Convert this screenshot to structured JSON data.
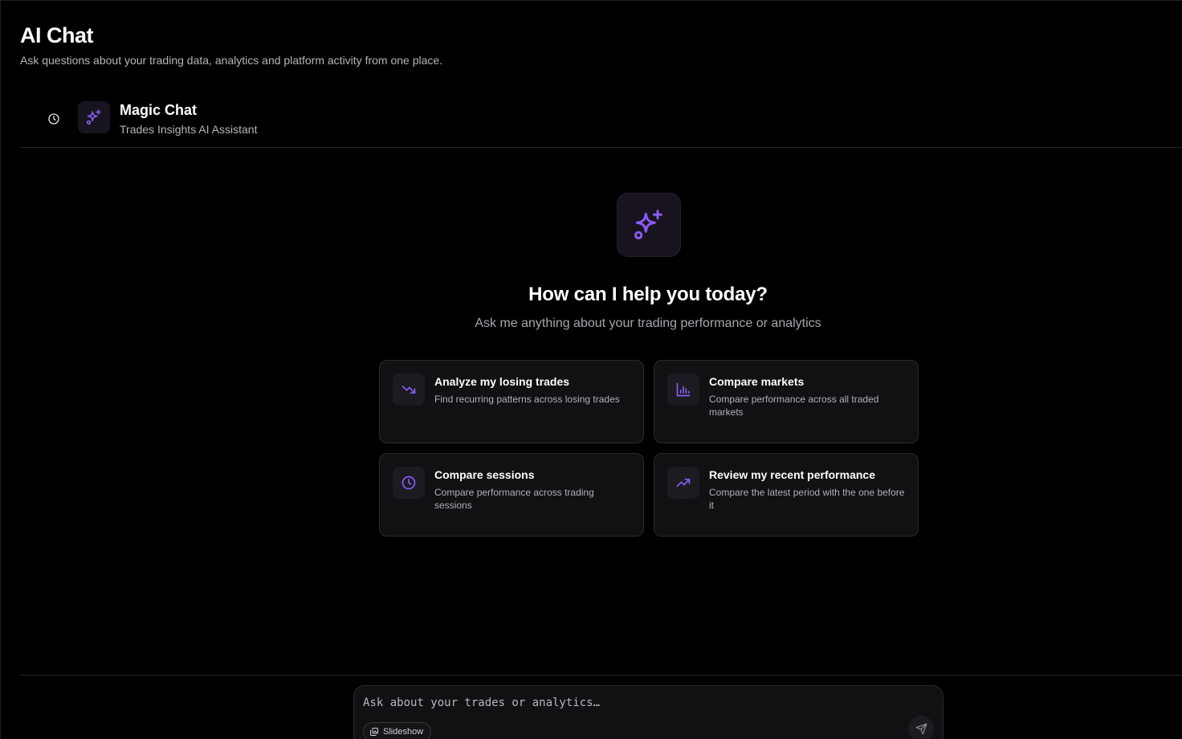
{
  "page": {
    "title": "AI Chat",
    "subtitle": "Ask questions about your trading data, analytics and platform activity from one place."
  },
  "chat_header": {
    "history_icon": "clock-icon",
    "avatar_icon": "sparkles-icon",
    "assistant_name": "Magic Chat",
    "assistant_role": "Trades Insights AI Assistant"
  },
  "hero": {
    "icon": "sparkles-icon",
    "title": "How can I help you today?",
    "subtitle": "Ask me anything about your trading performance or analytics"
  },
  "suggestions": [
    {
      "icon": "trending-down-icon",
      "title": "Analyze my losing trades",
      "description": "Find recurring patterns across losing trades"
    },
    {
      "icon": "bar-chart-icon",
      "title": "Compare markets",
      "description": "Compare performance across all traded markets"
    },
    {
      "icon": "clock-icon",
      "title": "Compare sessions",
      "description": "Compare performance across trading sessions"
    },
    {
      "icon": "trending-up-icon",
      "title": "Review my recent performance",
      "description": "Compare the latest period with the one before it"
    }
  ],
  "composer": {
    "placeholder": "Ask about your trades or analytics…",
    "value": "",
    "slideshow_label": "Slideshow",
    "send_icon": "send-icon"
  },
  "colors": {
    "background": "#000000",
    "accent": "#8b5cf6",
    "card": "#111113",
    "border": "#2a2a2f",
    "muted_text": "#b4b4bb"
  }
}
